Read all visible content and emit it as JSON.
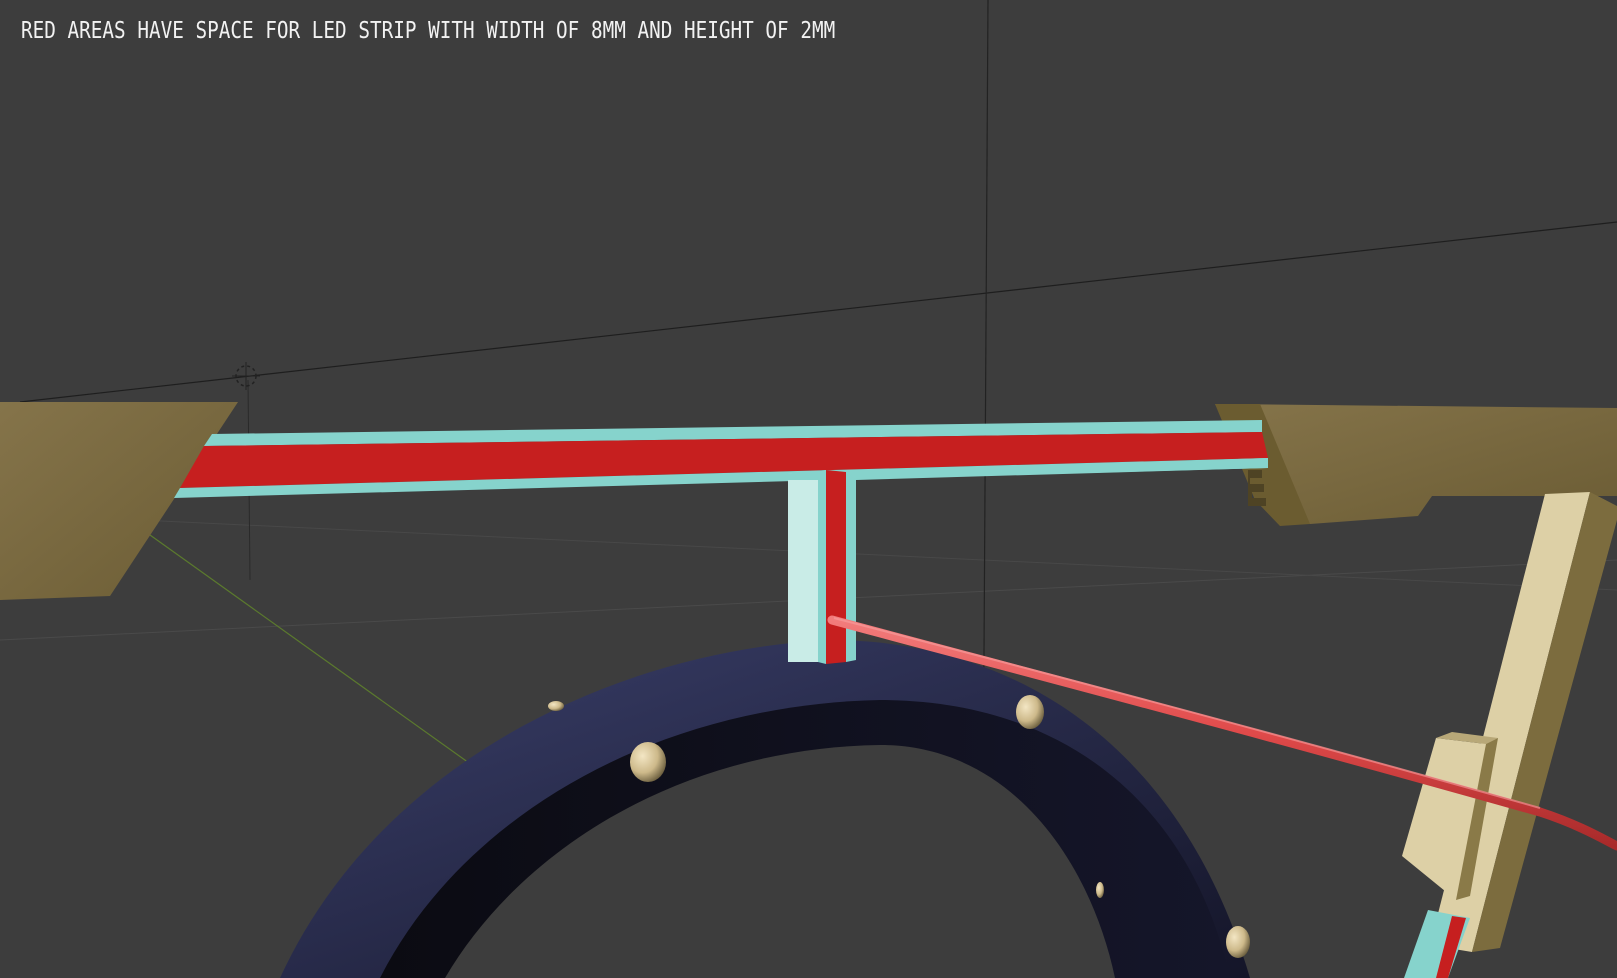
{
  "viewport": {
    "caption": "RED AREAS HAVE SPACE FOR LED STRIP WITH WIDTH OF 8MM AND HEIGHT OF 2MM"
  },
  "colors": {
    "background": "#3d3d3d",
    "led_strip_channel": "#c61f1f",
    "channel_wall": "#86d3cc",
    "mount_bracket": "#7a6a3c",
    "ring": "#262a45",
    "bolt_hole": "#d9c8a0",
    "cable": "#e04a4a"
  },
  "icons": {
    "origin_marker": "3d-cursor-icon"
  }
}
